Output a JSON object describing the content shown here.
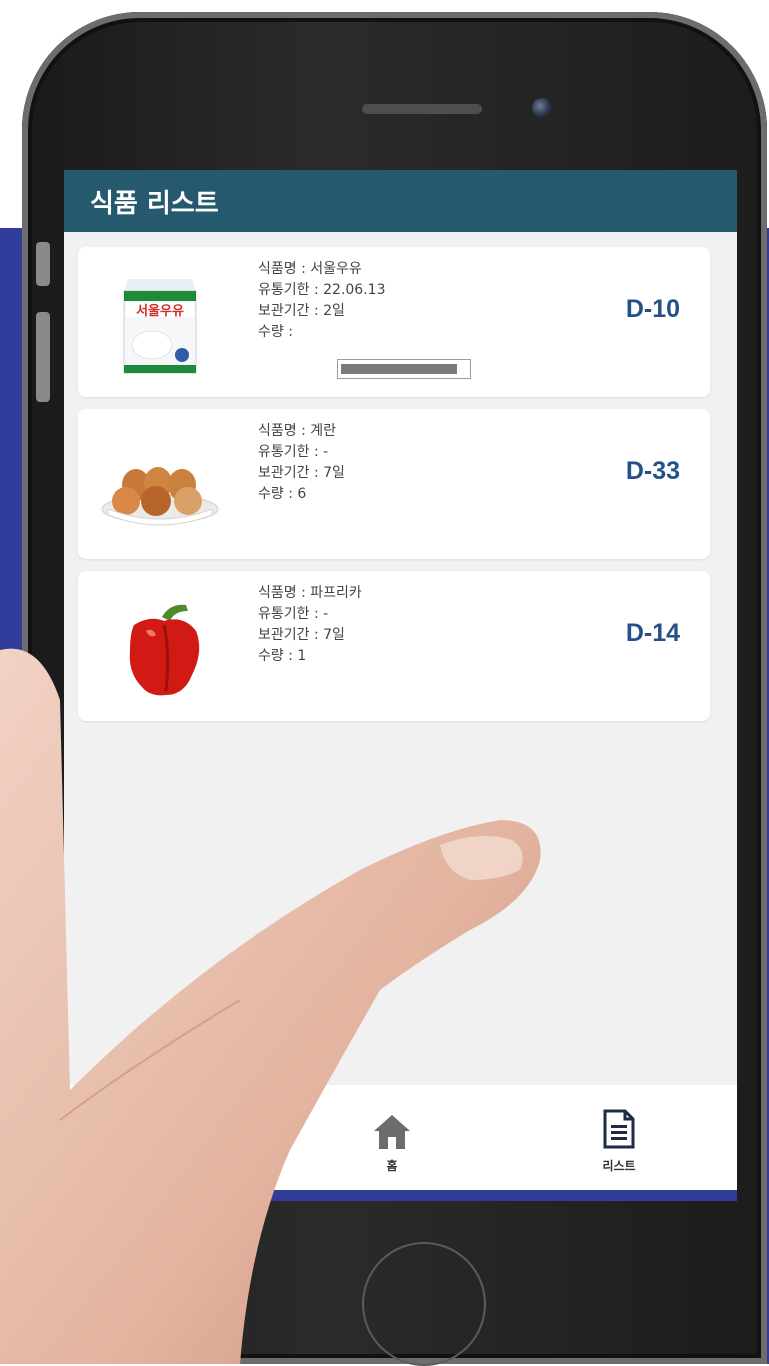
{
  "app": {
    "title": "식품 리스트"
  },
  "items": [
    {
      "name_line": "식품명 : 서울우유",
      "expiry_line": "유통기한 : 22.06.13",
      "storage_line": "보관기간 : 2일",
      "qty_line": "수량 :",
      "dday": "D-10",
      "image": "milk-carton"
    },
    {
      "name_line": "식품명 : 계란",
      "expiry_line": "유통기한 : -",
      "storage_line": "보관기간 : 7일",
      "qty_line": "수량 : 6",
      "dday": "D-33",
      "image": "egg-tray"
    },
    {
      "name_line": "식품명 : 파프리카",
      "expiry_line": "유통기한 : -",
      "storage_line": "보관기간 : 7일",
      "qty_line": "수량 : 1",
      "dday": "D-14",
      "image": "red-paprika"
    }
  ],
  "tabs": [
    {
      "label": "홈",
      "icon": "home-icon"
    },
    {
      "label": "리스트",
      "icon": "document-list-icon"
    }
  ],
  "colors": {
    "header": "#24596e",
    "dday_text": "#24508a",
    "background_panel": "#2f3c9a"
  }
}
